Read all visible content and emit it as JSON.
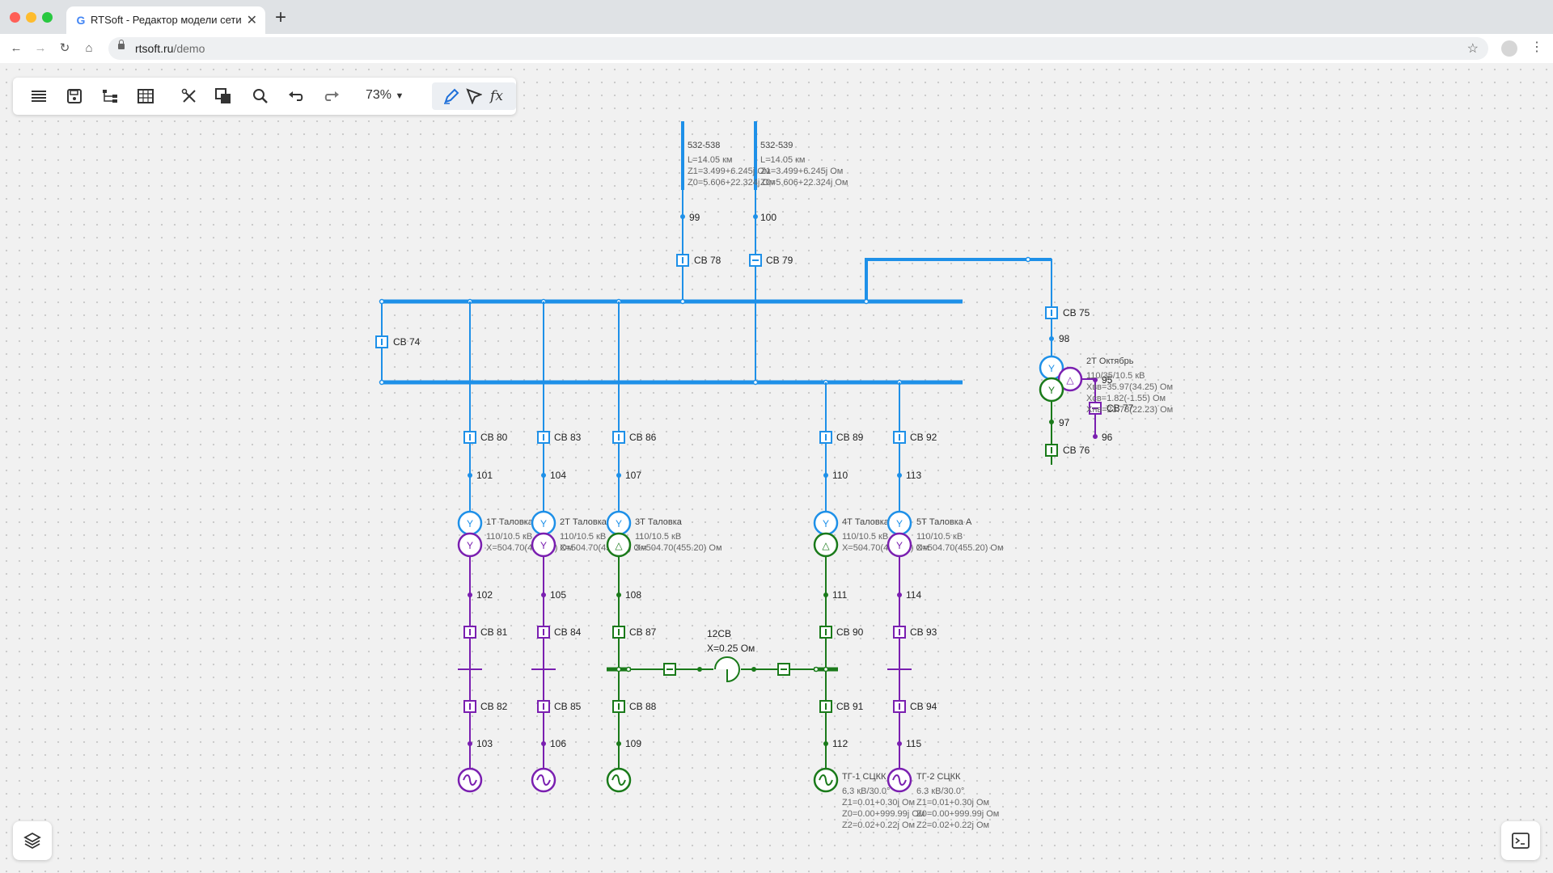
{
  "browser": {
    "tab_title": "RTSoft - Редактор модели сети",
    "favicon": "G",
    "url_domain": "rtsoft.ru",
    "url_path": "/demo",
    "new_tab": "+",
    "close": "✕"
  },
  "toolbar": {
    "zoom": "73%",
    "icons": [
      "menu-icon",
      "save-icon",
      "tree-icon",
      "table-icon",
      "tools-icon",
      "layers-copy-icon",
      "search-icon",
      "undo-icon",
      "redo-icon",
      "pen-icon",
      "select-icon",
      "formula-icon"
    ],
    "formula_label": "fx"
  },
  "colors": {
    "bus110": "#1e90e8",
    "lv_purple": "#7a1fb0",
    "lv_green": "#1a7a1a",
    "label": "#222222",
    "param": "#666666"
  },
  "lines": [
    {
      "name": "532-538",
      "length": "L=14.05 км",
      "z1": "Z1=3.499+6.245j Ом",
      "z0": "Z0=5.606+22.324j Ом"
    },
    {
      "name": "532-539",
      "length": "L=14.05 км",
      "z1": "Z1=3.499+6.245j Ом",
      "z0": "Z0=5.606+22.324j Ом"
    }
  ],
  "nodes": {
    "n99": "99",
    "n100": "100",
    "n98": "98",
    "n97": "97",
    "n96": "96",
    "n95": "95",
    "n101": "101",
    "n104": "104",
    "n107": "107",
    "n110": "110",
    "n113": "113",
    "n102": "102",
    "n105": "105",
    "n108": "108",
    "n111": "111",
    "n114": "114",
    "n103": "103",
    "n106": "106",
    "n109": "109",
    "n112": "112",
    "n115": "115"
  },
  "breakers": {
    "cb78": "СВ 78",
    "cb79": "СВ 79",
    "cb74": "СВ 74",
    "cb75": "СВ 75",
    "cb76": "СВ 76",
    "cb77": "СВ 77",
    "cb80": "СВ 80",
    "cb83": "СВ 83",
    "cb86": "СВ 86",
    "cb89": "СВ 89",
    "cb92": "СВ 92",
    "cb81": "СВ 81",
    "cb84": "СВ 84",
    "cb87": "СВ 87",
    "cb90": "СВ 90",
    "cb93": "СВ 93",
    "cb82": "СВ 82",
    "cb85": "СВ 85",
    "cb88": "СВ 88",
    "cb91": "СВ 91",
    "cb94": "СВ 94"
  },
  "transformers": {
    "t2okt": {
      "name": "2Т Октябрь",
      "ratio": "110/35/10.5 кВ",
      "xv": "Xвв=35.97(34.25) Ом",
      "xs": "Xсв=1.82(-1.55) Ом",
      "xn": "Xнв=23.78(22.23) Ом"
    },
    "t1": {
      "name": "1Т Таловка",
      "ratio": "110/10.5 кВ",
      "x": "X=504.70(455.20) Ом"
    },
    "t2": {
      "name": "2Т Таловка",
      "ratio": "110/10.5 кВ",
      "x": "X=504.70(455.20) Ом"
    },
    "t3": {
      "name": "3Т Таловка",
      "ratio": "110/10.5 кВ",
      "x": "X=504.70(455.20) Ом"
    },
    "t4": {
      "name": "4Т Таловка А",
      "ratio": "110/10.5 кВ",
      "x": "X=504.70(455.20) Ом"
    },
    "t5": {
      "name": "5Т Таловка А",
      "ratio": "110/10.5 кВ",
      "x": "X=504.70(455.20) Ом"
    }
  },
  "reactor": {
    "name": "12СВ",
    "x": "X=0.25 Ом"
  },
  "generators": {
    "tg1": {
      "name": "ТГ-1 СЦКК",
      "rating": "6.3 кВ/30.0°",
      "z1": "Z1=0.01+0.30j Ом",
      "z0": "Z0=0.00+999.99j Ом",
      "z2": "Z2=0.02+0.22j Ом"
    },
    "tg2": {
      "name": "ТГ-2 СЦКК",
      "rating": "6.3 кВ/30.0°",
      "z1": "Z1=0.01+0.30j Ом",
      "z0": "Z0=0.00+999.99j Ом",
      "z2": "Z2=0.02+0.22j Ом"
    }
  }
}
